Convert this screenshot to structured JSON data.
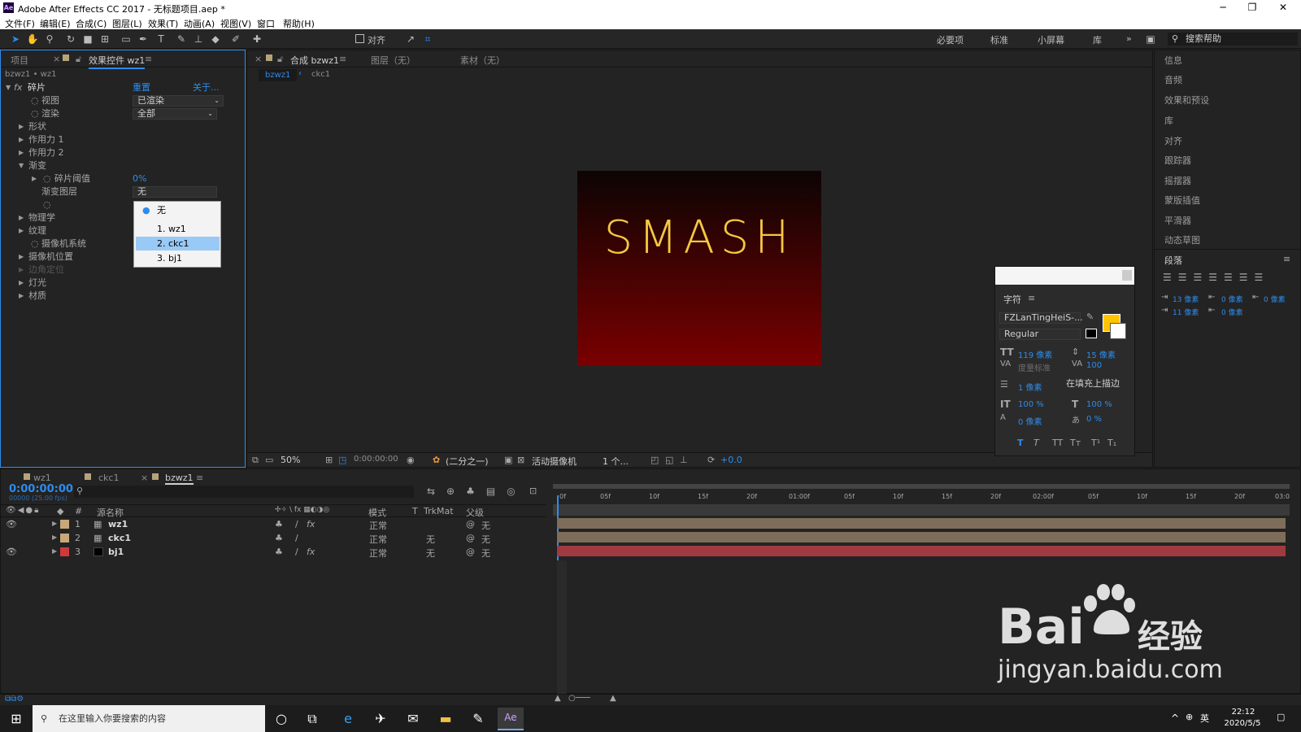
{
  "window": {
    "title": "Adobe After Effects CC 2017 - 无标题项目.aep *",
    "app_badge": "Ae",
    "minimize": "─",
    "restore": "❐",
    "close": "✕"
  },
  "menu": [
    "文件(F)",
    "编辑(E)",
    "合成(C)",
    "图层(L)",
    "效果(T)",
    "动画(A)",
    "视图(V)",
    "窗口",
    "帮助(H)"
  ],
  "toolbar": {
    "align_label": "对齐",
    "workspaces": [
      "必要项",
      "标准",
      "小屏幕",
      "库"
    ],
    "more": "»",
    "search_help": "搜索帮助"
  },
  "left_panel": {
    "tab_project": "项目",
    "tab_effects": "效果控件 wz1",
    "breadcrumb": "bzwz1 • wz1",
    "effect_name": "碎片",
    "reset": "重置",
    "about": "关于...",
    "view_label": "视图",
    "view_value": "已渲染",
    "render_label": "渲染",
    "render_value": "全部",
    "props": [
      "形状",
      "作用力 1",
      "作用力 2",
      "渐变"
    ],
    "threshold_label": "碎片阈值",
    "threshold_value": "0%",
    "gradient_layer_label": "渐变图层",
    "gradient_layer_value": "无",
    "more_props": [
      "物理学",
      "纹理",
      "摄像机系统",
      "摄像机位置",
      "边角定位",
      "灯光",
      "材质"
    ],
    "popup": {
      "options": [
        "无",
        "1. wz1",
        "2. ckc1",
        "3. bj1"
      ],
      "selected_index": 2,
      "checked_index": 0
    }
  },
  "comp_panel": {
    "tab": "合成 bzwz1",
    "tab_layer": "图层（无）",
    "tab_footage": "素材（无）",
    "crumbs": [
      "bzwz1",
      "ckc1"
    ],
    "canvas_text": "SMASH",
    "colors": {
      "text": "#f5c842",
      "top": "#0c0404",
      "bottom": "#7a0000"
    },
    "footer": {
      "zoom": "50%",
      "time": "0:00:00:00",
      "res": "(二分之一)",
      "camera": "活动摄像机",
      "views": "1 个...",
      "exposure": "+0.0"
    }
  },
  "char_panel": {
    "title": "字符",
    "font": "FZLanTingHeiS-...",
    "style": "Regular",
    "size": "119 像素",
    "leading": "15 像素",
    "kerning": "度量标准",
    "tracking": "100",
    "stroke": "1 像素",
    "stroke_mode": "在填充上描边",
    "vscale": "100 %",
    "hscale": "100 %",
    "baseline": "0 像素",
    "tsume": "0 %",
    "styles": [
      "T",
      "T",
      "TT",
      "Tт",
      "T¹",
      "T₁"
    ],
    "fill_color": "#ffc400"
  },
  "right_panel": {
    "items": [
      "信息",
      "音频",
      "效果和预设",
      "库",
      "对齐",
      "跟踪器",
      "摇摆器",
      "蒙版插值",
      "平滑器",
      "动态草图"
    ],
    "paragraph": "段落",
    "indent": [
      "13 像素",
      "0 像素",
      "0 像素",
      "11 像素",
      "0 像素"
    ]
  },
  "timeline": {
    "tabs": [
      "wz1",
      "ckc1",
      "bzwz1"
    ],
    "timecode": "0:00:00:00",
    "fps": "00000 (25.00 fps)",
    "headers": {
      "num": "#",
      "name": "源名称",
      "mode": "模式",
      "t": "T",
      "trkmat": "TrkMat",
      "parent": "父级"
    },
    "layers": [
      {
        "num": "1",
        "name": "wz1",
        "mode": "正常",
        "trkmat": "",
        "parent": "无",
        "label_color": "#c8a87a",
        "fx": "fx"
      },
      {
        "num": "2",
        "name": "ckc1",
        "mode": "正常",
        "trkmat": "无",
        "parent": "无",
        "label_color": "#c8a87a",
        "fx": ""
      },
      {
        "num": "3",
        "name": "bj1",
        "mode": "正常",
        "trkmat": "无",
        "parent": "无",
        "label_color": "#d0393c",
        "fx": "fx"
      }
    ],
    "ruler": [
      "0f",
      "05f",
      "10f",
      "15f",
      "20f",
      "01:00f",
      "05f",
      "10f",
      "15f",
      "20f",
      "02:00f",
      "05f",
      "10f",
      "15f",
      "20f",
      "03:0"
    ],
    "bar_colors": [
      "#7d6d5a",
      "#7d6d5a",
      "#a03a40"
    ]
  },
  "watermark": {
    "brand": "Bai",
    "brand2": "经验",
    "url": "jingyan.baidu.com"
  },
  "taskbar": {
    "search": "在这里输入你要搜索的内容",
    "time": "22:12",
    "date": "2020/5/5",
    "ime": "英"
  }
}
